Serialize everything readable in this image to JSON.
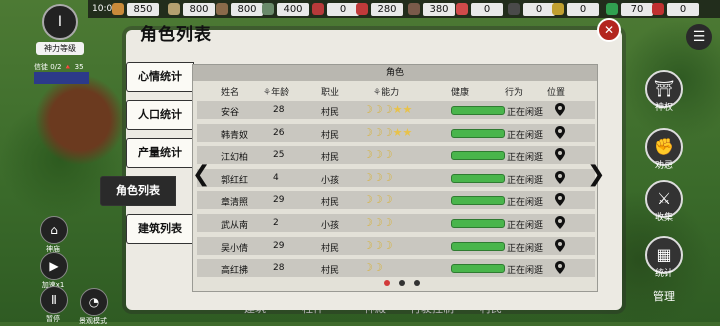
{
  "hud": {
    "time": "10:00",
    "speed_label": "6",
    "resources": [
      "850",
      "800",
      "800",
      "400",
      "0",
      "280",
      "380",
      "0",
      "0",
      "0",
      "70",
      "0"
    ],
    "god_level_label": "神力等级",
    "status_line": "信徒 0/2  🔺 35",
    "flag_text": "",
    "left_controls": [
      {
        "icon": "home-icon",
        "label": "神庙"
      },
      {
        "icon": "play-icon",
        "label": "加速x1"
      },
      {
        "icon": "pause-icon",
        "label": "暂停"
      },
      {
        "icon": "view-icon",
        "label": "景观模式"
      }
    ],
    "right_buttons": [
      {
        "icon": "temple-icon",
        "label": "神权"
      },
      {
        "icon": "arm-icon",
        "label": "劝忌"
      },
      {
        "icon": "sword-icon",
        "label": "收集"
      },
      {
        "icon": "chart-icon",
        "label": "统计"
      }
    ],
    "manage_label": "管理",
    "bottom_tabs": [
      "建筑",
      "柱件",
      "神殿",
      "行驶控制",
      "村民"
    ]
  },
  "panel": {
    "title": "角色列表",
    "tabs": [
      {
        "label": "心情统计",
        "active": false
      },
      {
        "label": "人口统计",
        "active": false
      },
      {
        "label": "产量统计",
        "active": false
      },
      {
        "label": "角色列表",
        "active": true
      },
      {
        "label": "建筑列表",
        "active": false
      }
    ],
    "group_header": "角色",
    "columns": {
      "name": "姓名",
      "age": "年龄",
      "job": "职业",
      "ability": "能力",
      "health": "健康",
      "action": "行为",
      "location": "位置"
    },
    "rows": [
      {
        "name": "安谷",
        "age": "28",
        "job": "村民",
        "moons": 3,
        "stars": 2,
        "health": 1.0,
        "action": "正在闲逛"
      },
      {
        "name": "韩青奴",
        "age": "26",
        "job": "村民",
        "moons": 3,
        "stars": 2,
        "health": 1.0,
        "action": "正在闲逛"
      },
      {
        "name": "江幻柏",
        "age": "25",
        "job": "村民",
        "moons": 3,
        "stars": 0,
        "health": 1.0,
        "action": "正在闲逛"
      },
      {
        "name": "郭红红",
        "age": "4",
        "job": "小孩",
        "moons": 3,
        "stars": 0,
        "health": 1.0,
        "action": "正在闲逛"
      },
      {
        "name": "章清照",
        "age": "29",
        "job": "村民",
        "moons": 3,
        "stars": 0,
        "health": 1.0,
        "action": "正在闲逛"
      },
      {
        "name": "武从南",
        "age": "2",
        "job": "小孩",
        "moons": 3,
        "stars": 0,
        "health": 1.0,
        "action": "正在闲逛"
      },
      {
        "name": "吴小倩",
        "age": "29",
        "job": "村民",
        "moons": 3,
        "stars": 0,
        "health": 1.0,
        "action": "正在闲逛"
      },
      {
        "name": "高红拂",
        "age": "28",
        "job": "村民",
        "moons": 2,
        "stars": 0,
        "health": 1.0,
        "action": "正在闲逛"
      }
    ],
    "page_count": 3,
    "current_page": 1
  }
}
